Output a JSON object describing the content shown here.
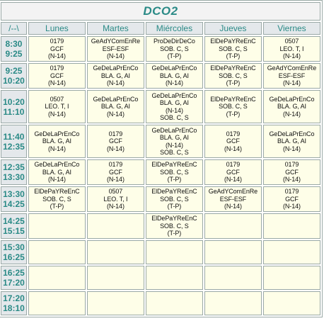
{
  "title": "DCO2",
  "corner": "/--\\",
  "days": [
    "Lunes",
    "Martes",
    "Miércoles",
    "Jueves",
    "Viernes"
  ],
  "rows": [
    {
      "start": "8:30",
      "end": "9:25",
      "h": 36,
      "cells": [
        [
          "0179",
          "GCF",
          "(N-14)"
        ],
        [
          "GeAdYComEnRe",
          "ESF-ESF",
          "(N-14)"
        ],
        [
          "ProDeDirDeCo",
          "SOB. C, S",
          "(T-P)"
        ],
        [
          "ElDePaYReEnC",
          "SOB. C, S",
          "(T-P)"
        ],
        [
          "0507",
          "LEO. T, I",
          "(N-14)"
        ]
      ]
    },
    {
      "start": "9:25",
      "end": "10:20",
      "h": 36,
      "cells": [
        [
          "0179",
          "GCF",
          "(N-14)"
        ],
        [
          "GeDeLaPrEnCo",
          "BLA. G, AI",
          "(N-14)"
        ],
        [
          "GeDeLaPrEnCo",
          "BLA. G, AI",
          "(N-14)"
        ],
        [
          "ElDePaYReEnC",
          "SOB. C, S",
          "(T-P)"
        ],
        [
          "GeAdYComEnRe",
          "ESF-ESF",
          "(N-14)"
        ]
      ]
    },
    {
      "start": "10:20",
      "end": "11:10",
      "h": 47,
      "cells": [
        [
          "0507",
          "LEO. T, I",
          "(N-14)"
        ],
        [
          "GeDeLaPrEnCo",
          "BLA. G, AI",
          "(N-14)"
        ],
        [
          "GeDeLaPrEnCo",
          "BLA. G, AI",
          "(N-14)",
          "SOB. C, S"
        ],
        [
          "ElDePaYReEnC",
          "SOB. C, S",
          "(T-P)"
        ],
        [
          "GeDeLaPrEnCo",
          "BLA. G, AI",
          "(N-14)"
        ]
      ]
    },
    {
      "start": "11:40",
      "end": "12:35",
      "h": 47,
      "cells": [
        [
          "GeDeLaPrEnCo",
          "BLA. G, AI",
          "(N-14)"
        ],
        [
          "0179",
          "GCF",
          "(N-14)"
        ],
        [
          "GeDeLaPrEnCo",
          "BLA. G, AI",
          "(N-14)",
          "SOB. C, S"
        ],
        [
          "0179",
          "GCF",
          "(N-14)"
        ],
        [
          "GeDeLaPrEnCo",
          "BLA. G, AI",
          "(N-14)"
        ]
      ]
    },
    {
      "start": "12:35",
      "end": "13:30",
      "h": 36,
      "cells": [
        [
          "GeDeLaPrEnCo",
          "BLA. G, AI",
          "(N-14)"
        ],
        [
          "0179",
          "GCF",
          "(N-14)"
        ],
        [
          "ElDePaYReEnC",
          "SOB. C, S",
          "(T-P)"
        ],
        [
          "0179",
          "GCF",
          "(N-14)"
        ],
        [
          "0179",
          "GCF",
          "(N-14)"
        ]
      ]
    },
    {
      "start": "13:30",
      "end": "14:25",
      "h": 36,
      "cells": [
        [
          "ElDePaYReEnC",
          "SOB. C, S",
          "(T-P)"
        ],
        [
          "0507",
          "LEO. T, I",
          "(N-14)"
        ],
        [
          "ElDePaYReEnC",
          "SOB. C, S",
          "(T-P)"
        ],
        [
          "GeAdYComEnRe",
          "ESF-ESF",
          "(N-14)"
        ],
        [
          "0179",
          "GCF",
          "(N-14)"
        ]
      ]
    },
    {
      "start": "14:25",
      "end": "15:15",
      "h": 36,
      "cells": [
        [],
        [],
        [
          "ElDePaYReEnC",
          "SOB. C, S",
          "(T-P)"
        ],
        [],
        []
      ]
    },
    {
      "start": "15:30",
      "end": "16:25",
      "h": 34,
      "cells": [
        [],
        [],
        [],
        [],
        []
      ]
    },
    {
      "start": "16:25",
      "end": "17:20",
      "h": 34,
      "cells": [
        [],
        [],
        [],
        [],
        []
      ]
    },
    {
      "start": "17:20",
      "end": "18:10",
      "h": 34,
      "cells": [
        [],
        [],
        [],
        [],
        []
      ]
    }
  ]
}
